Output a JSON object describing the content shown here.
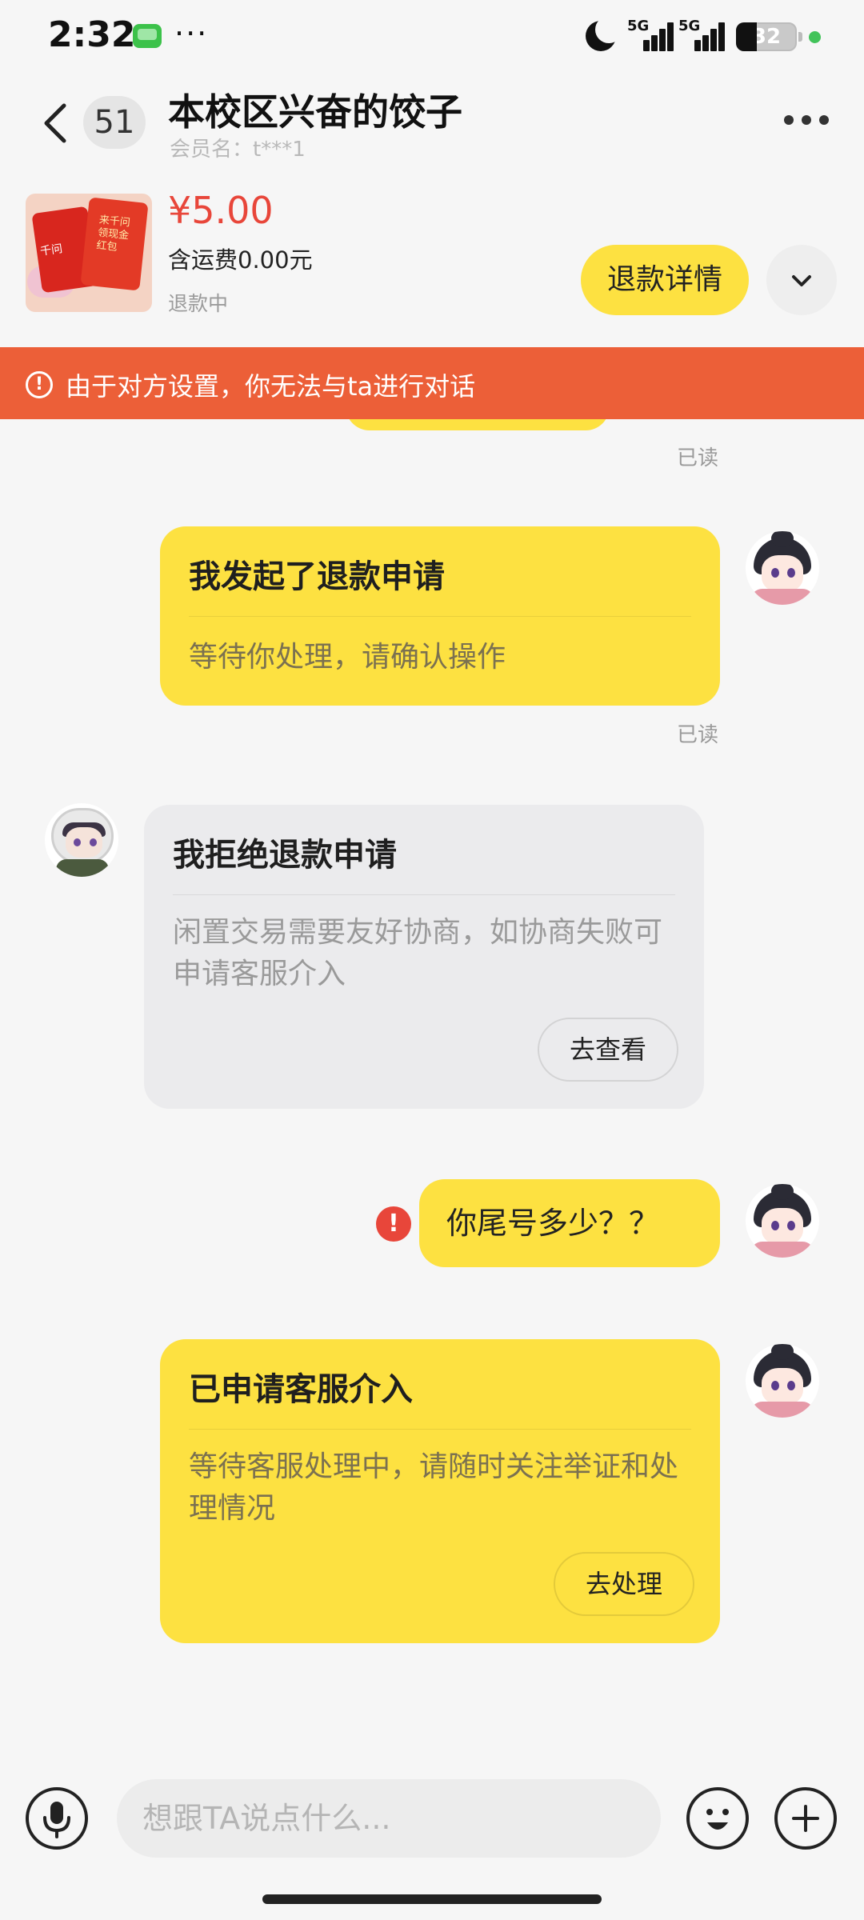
{
  "status_bar": {
    "time": "2:32",
    "more": "···",
    "network_1": "5G",
    "network_2": "5G",
    "battery": "32"
  },
  "header": {
    "unread_count": "51",
    "title": "本校区兴奋的饺子",
    "member_name": "会员名：t***1"
  },
  "product": {
    "image_text_1": "千问",
    "image_text_2": "来千问领现金红包",
    "price": "¥5.00",
    "shipping": "含运费0.00元",
    "status": "退款中",
    "refund_detail_label": "退款详情"
  },
  "warning": {
    "text": "由于对方设置，你无法与ta进行对话"
  },
  "messages": {
    "read_label": "已读",
    "refund_request": {
      "title": "我发起了退款申请",
      "body": "等待你处理，请确认操作"
    },
    "refund_refused": {
      "title": "我拒绝退款申请",
      "body": "闲置交易需要友好协商，如协商失败可申请客服介入",
      "button": "去查看"
    },
    "text_message": "你尾号多少？？",
    "service_intervention": {
      "title": "已申请客服介入",
      "body": "等待客服处理中，请随时关注举证和处理情况",
      "button": "去处理"
    }
  },
  "input": {
    "placeholder": "想跟TA说点什么..."
  },
  "colors": {
    "accent_yellow": "#fde141",
    "warning_orange": "#ec5f38",
    "price_red": "#e8463a"
  }
}
